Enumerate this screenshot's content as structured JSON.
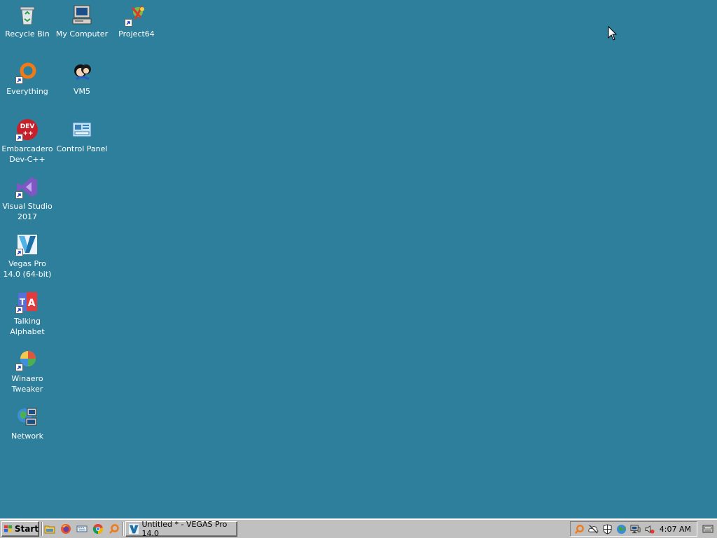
{
  "desktop": {
    "background": "#2e7f9b",
    "icons": [
      {
        "label": "Recycle Bin",
        "icon": "recycle-bin-icon"
      },
      {
        "label": "My Computer",
        "icon": "my-computer-icon"
      },
      {
        "label": "Project64",
        "icon": "project64-icon"
      },
      {
        "label": "Everything",
        "icon": "everything-icon"
      },
      {
        "label": "VM5",
        "icon": "vm5-icon"
      },
      {
        "label": "Embarcadero\nDev-C++",
        "icon": "dev-cpp-icon"
      },
      {
        "label": "Control Panel",
        "icon": "control-panel-icon"
      },
      {
        "label": "Visual Studio\n2017",
        "icon": "visual-studio-icon"
      },
      {
        "label": "Vegas Pro\n14.0 (64-bit)",
        "icon": "vegas-pro-icon"
      },
      {
        "label": "Talking\nAlphabet",
        "icon": "talking-alphabet-icon"
      },
      {
        "label": "Winaero\nTweaker",
        "icon": "winaero-tweaker-icon"
      },
      {
        "label": "Network",
        "icon": "network-icon"
      }
    ]
  },
  "taskbar": {
    "start_label": "Start",
    "quick_launch": [
      "folder-icon",
      "firefox-icon",
      "keyboard-icon",
      "chrome-icon",
      "everything-search-icon"
    ],
    "task": {
      "label": "Untitled * - VEGAS Pro 14.0",
      "icon": "vegas-pro-icon"
    },
    "tray": [
      "everything-search-icon",
      "cloud-offline-icon",
      "security-shield-icon",
      "globe-icon",
      "network-status-icon",
      "volume-muted-icon"
    ],
    "clock": "4:07 AM"
  }
}
